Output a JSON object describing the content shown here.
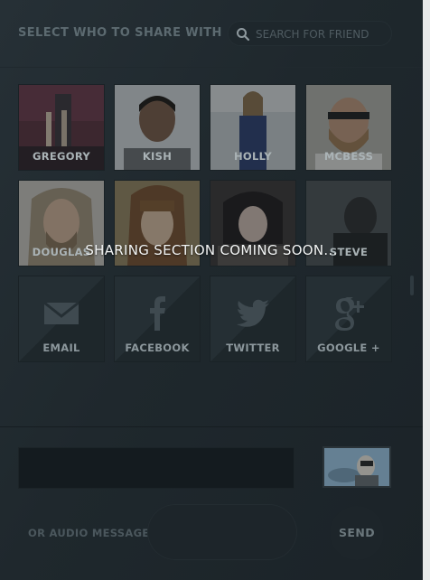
{
  "header": {
    "title": "SELECT WHO TO SHARE WITH",
    "search_placeholder": "SEARCH FOR FRIEND"
  },
  "friends": [
    {
      "name": "GREGORY"
    },
    {
      "name": "KISH"
    },
    {
      "name": "HOLLY"
    },
    {
      "name": "MCBESS"
    },
    {
      "name": "DOUGLAS"
    },
    {
      "name": ""
    },
    {
      "name": ""
    },
    {
      "name": "STEVE"
    }
  ],
  "share_services": [
    {
      "label": "EMAIL",
      "icon": "envelope-icon"
    },
    {
      "label": "FACEBOOK",
      "icon": "facebook-icon"
    },
    {
      "label": "TWITTER",
      "icon": "twitter-bird-icon"
    },
    {
      "label": "GOOGLE +",
      "icon": "google-plus-icon"
    }
  ],
  "overlay_message": "SHARING SECTION COMING SOON...",
  "footer": {
    "audio_label": "OR AUDIO MESSAGE",
    "send_label": "SEND"
  }
}
